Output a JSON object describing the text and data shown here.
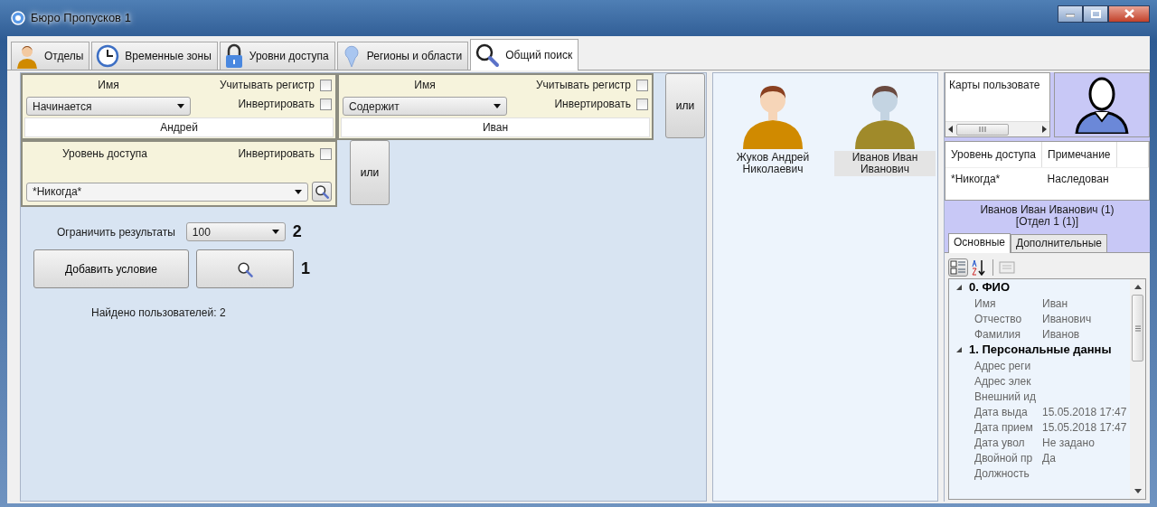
{
  "window": {
    "title": "Бюро Пропусков 1"
  },
  "tabs": [
    {
      "label": "Отделы",
      "kind": "person",
      "selected": false
    },
    {
      "label": "Временные зоны",
      "kind": "clock",
      "selected": false
    },
    {
      "label": "Уровни доступа",
      "kind": "lock",
      "selected": false
    },
    {
      "label": "Регионы и области",
      "kind": "pin",
      "selected": false
    },
    {
      "label": "Общий поиск",
      "kind": "search",
      "selected": true
    }
  ],
  "conditions": [
    {
      "kind": "text",
      "field": "Имя",
      "case_label": "Учитывать регистр",
      "case_checked": false,
      "invert_label": "Инвертировать",
      "invert_checked": false,
      "mode": "Начинается",
      "value": "Андрей"
    },
    {
      "kind": "text",
      "field": "Имя",
      "case_label": "Учитывать регистр",
      "case_checked": false,
      "invert_label": "Инвертировать",
      "invert_checked": false,
      "mode": "Содержит",
      "value": "Иван"
    },
    {
      "kind": "level",
      "field": "Уровень доступа",
      "invert_label": "Инвертировать",
      "invert_checked": false,
      "value": "*Никогда*"
    }
  ],
  "or_buttons": [
    "или",
    "или"
  ],
  "limit": {
    "label": "Ограничить результаты",
    "value": "100",
    "marker": "2"
  },
  "add_button": "Добавить условие",
  "search_marker": "1",
  "found": "Найдено пользователей: 2",
  "users": [
    {
      "name": "Жуков Андрей Николаевич",
      "kind": "normal",
      "color": "#d08a00",
      "selected": false
    },
    {
      "name": "Иванов Иван Иванович",
      "kind": "grey",
      "color": "#a08a2a",
      "selected": true
    }
  ],
  "cards": {
    "column": "Карты пользовате"
  },
  "access_table": {
    "columns": [
      "Уровень доступа",
      "Примечание"
    ],
    "rows": [
      [
        "*Никогда*",
        "Наследован"
      ]
    ]
  },
  "selected_user": {
    "name": "Иванов Иван Иванович (1)",
    "department": "[Отдел 1 (1)]"
  },
  "detail_tabs": [
    {
      "label": "Основные",
      "selected": true
    },
    {
      "label": "Дополнительные",
      "selected": false
    }
  ],
  "properties": [
    {
      "title": "0. ФИО",
      "expanded": true,
      "rows": [
        {
          "name": "Имя",
          "value": "Иван"
        },
        {
          "name": "Отчество",
          "value": "Иванович"
        },
        {
          "name": "Фамилия",
          "value": "Иванов"
        }
      ]
    },
    {
      "title": "1. Персональные данны",
      "expanded": true,
      "rows": [
        {
          "name": "Адрес реги"
        },
        {
          "name": "Адрес элек"
        },
        {
          "name": "Внешний ид"
        },
        {
          "name": "Дата выда",
          "value": "15.05.2018 17:47"
        },
        {
          "name": "Дата прием",
          "value": "15.05.2018 17:47"
        },
        {
          "name": "Дата увол",
          "value": "Не задано"
        },
        {
          "name": "Двойной пр",
          "value": "Да"
        },
        {
          "name": "Должность"
        }
      ]
    }
  ]
}
